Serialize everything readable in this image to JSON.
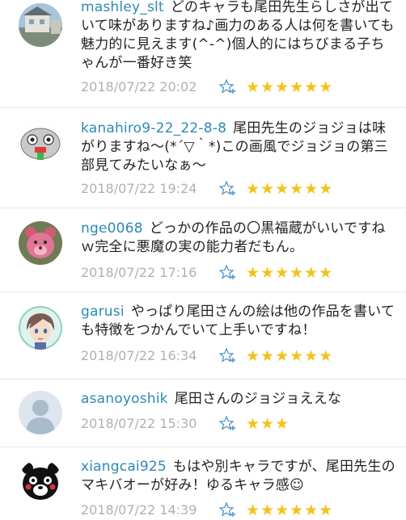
{
  "comments": [
    {
      "user": "mashley_slt",
      "text": "どのキャラも尾田先生らしさが出ていて味がありますね♪画力のある人は何を書いても魅力的に見えます(^-^)個人的にはちびまる子ちゃんが一番好き笑",
      "date": "2018/07/22 20:02",
      "rating": "★★★★★★",
      "avatar_icon": "house-photo-avatar"
    },
    {
      "user": "kanahiro9-22_22-8-8",
      "text": "尾田先生のジョジョは味がりますね～(*´▽｀*)この画風でジョジョの第三部見てみたいなぁ～",
      "date": "2018/07/22 19:24",
      "rating": "★★★★★★",
      "avatar_icon": "robot-face-avatar"
    },
    {
      "user": "nge0068",
      "text": "どっかの作品の〇黒福蔵がいいですねｗ完全に悪魔の実の能力者だもん。",
      "date": "2018/07/22 17:16",
      "rating": "★★★★★★",
      "avatar_icon": "pink-bear-avatar"
    },
    {
      "user": "garusi",
      "text": "やっぱり尾田さんの絵は他の作品を書いても特徴をつかんでいて上手いですね！",
      "date": "2018/07/22 16:34",
      "rating": "★★★★★★",
      "avatar_icon": "anime-character-avatar"
    },
    {
      "user": "asanoyoshik",
      "text": "尾田さんのジョジョええな",
      "date": "2018/07/22 15:30",
      "rating": "★★★",
      "avatar_icon": "default-user-avatar"
    },
    {
      "user": "xiangcai925",
      "text": "もはや別キャラですが、尾田先生のマキバオーが好み！ゆるキャラ感☺",
      "date": "2018/07/22 14:39",
      "rating": "★★★★★★",
      "avatar_icon": "black-bear-mascot-avatar"
    }
  ],
  "favorite_icon": "star-plus-icon",
  "colors": {
    "username": "#2b8ab6",
    "date": "#b0b0b0",
    "stars": "#f4c21b",
    "divider": "#e6e6e6"
  }
}
